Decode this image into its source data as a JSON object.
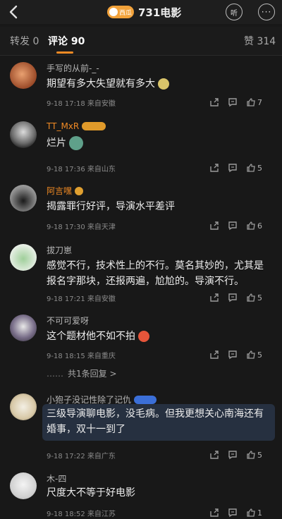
{
  "header": {
    "badge_text": "西瓜",
    "title": "731电影",
    "listen_label": "听",
    "more_label": "···"
  },
  "tabs": {
    "repost": "转发 0",
    "comments": "评论 90",
    "likes": "赞 314"
  },
  "comments": [
    {
      "name": "手写的从前-_-",
      "text": "期望有多大失望就有多大",
      "meta": "9-18 17:18  来自安徽",
      "likes": "7"
    },
    {
      "name": "TT_MxR",
      "text": "烂片",
      "meta": "9-18 17:36  来自山东",
      "likes": "5"
    },
    {
      "name": "阿言嘿",
      "text": "揭露罪行好评，导演水平差评",
      "meta": "9-18 17:30  来自天津",
      "likes": "6"
    },
    {
      "name": "拔刀崽",
      "text": "感觉不行，技术性上的不行。莫名其妙的，尤其是报名字那块，还报两遍，尬尬的。导演不行。",
      "meta": "9-18 17:21  来自安徽",
      "likes": "5"
    },
    {
      "name": "不可可爱呀",
      "text": "这个题材他不如不拍",
      "meta": "9-18 18:15  来自重庆",
      "likes": "5",
      "replies": "共1条回复 >"
    },
    {
      "name": "小狍子没记性除了记仇",
      "text": "三级导演聊电影，没毛病。但我更想关心南海还有婚事，双十一到了",
      "meta": "9-18 17:22  来自广东",
      "likes": "5"
    },
    {
      "name": "木-四",
      "text": "尺度大不等于好电影",
      "meta": "9-18 18:52  来自江苏",
      "likes": "1"
    }
  ],
  "reply_dots": "……",
  "colors": {
    "accent": "#f08a24",
    "background": "#181818",
    "badge": "#3b6fd8"
  },
  "icons": [
    "back-icon",
    "share-icon",
    "comment-icon",
    "like-icon",
    "headphones-icon",
    "more-icon"
  ]
}
